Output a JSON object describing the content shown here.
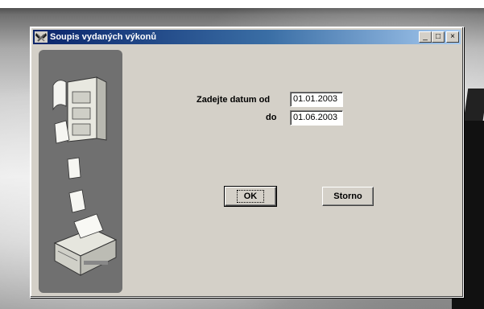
{
  "window": {
    "title": "Soupis vydaných výkonů",
    "minimize_glyph": "_",
    "maximize_glyph": "□",
    "close_glyph": "×"
  },
  "form": {
    "date_from_label": "Zadejte datum od",
    "date_from_value": "01.01.2003",
    "date_to_label": "do",
    "date_to_value": "01.06.2003"
  },
  "buttons": {
    "ok_label": "OK",
    "cancel_label": "Storno"
  },
  "icons": {
    "title": "tools-icon",
    "illustration": "filing-cabinet-printer-icon"
  },
  "colors": {
    "titlebar_start": "#0a246a",
    "titlebar_end": "#a6caf0",
    "window_face": "#d4d0c8",
    "side_panel": "#707070"
  }
}
